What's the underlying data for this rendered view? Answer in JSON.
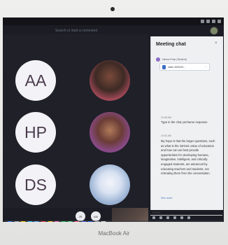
{
  "search": {
    "placeholder": "Search or start a command"
  },
  "participants": [
    {
      "initials": "AA"
    },
    {
      "initials": "HP"
    },
    {
      "initials": "DS"
    }
  ],
  "bottom_pills": [
    "JR",
    "AM"
  ],
  "chat": {
    "title": "Meeting chat",
    "close_label": "×",
    "sender": "Hanna Polar (Student)",
    "attachment_name": "video 2020/03...",
    "attachment_menu": "···",
    "messages": [
      {
        "time": "10:40 AM",
        "text": "Type in the chat yor/name response"
      },
      {
        "time": "10:41 AM",
        "text": "My hope is that the larger questions, such as what is the intrinsic value of education and how can we best provide opportunities for developing humane, imaginative, intelligent, and critically engaged students, are advanced by educating teachers and students, not retreating them from the conversation."
      }
    ],
    "see_more": "See more",
    "reply_label": "Reply"
  },
  "device": {
    "brand": "MacBook Air"
  },
  "colors": {
    "stage_bg": "#1f2028",
    "initials_tile_bg": "#f3f2f6",
    "initials_text": "#4a3c4e",
    "chat_bg": "#eef0f2"
  },
  "icons": {
    "menubar": [
      "wifi-icon",
      "battery-icon",
      "clock-icon",
      "search-icon"
    ],
    "dock": [
      "finder-icon",
      "launchpad-icon",
      "chrome-icon",
      "safari-icon",
      "mail-icon",
      "calendar-icon",
      "notes-icon",
      "photos-icon",
      "facetime-icon",
      "messages-icon",
      "music-icon",
      "teams-icon",
      "zoom-icon",
      "settings-icon",
      "trash-icon"
    ]
  }
}
